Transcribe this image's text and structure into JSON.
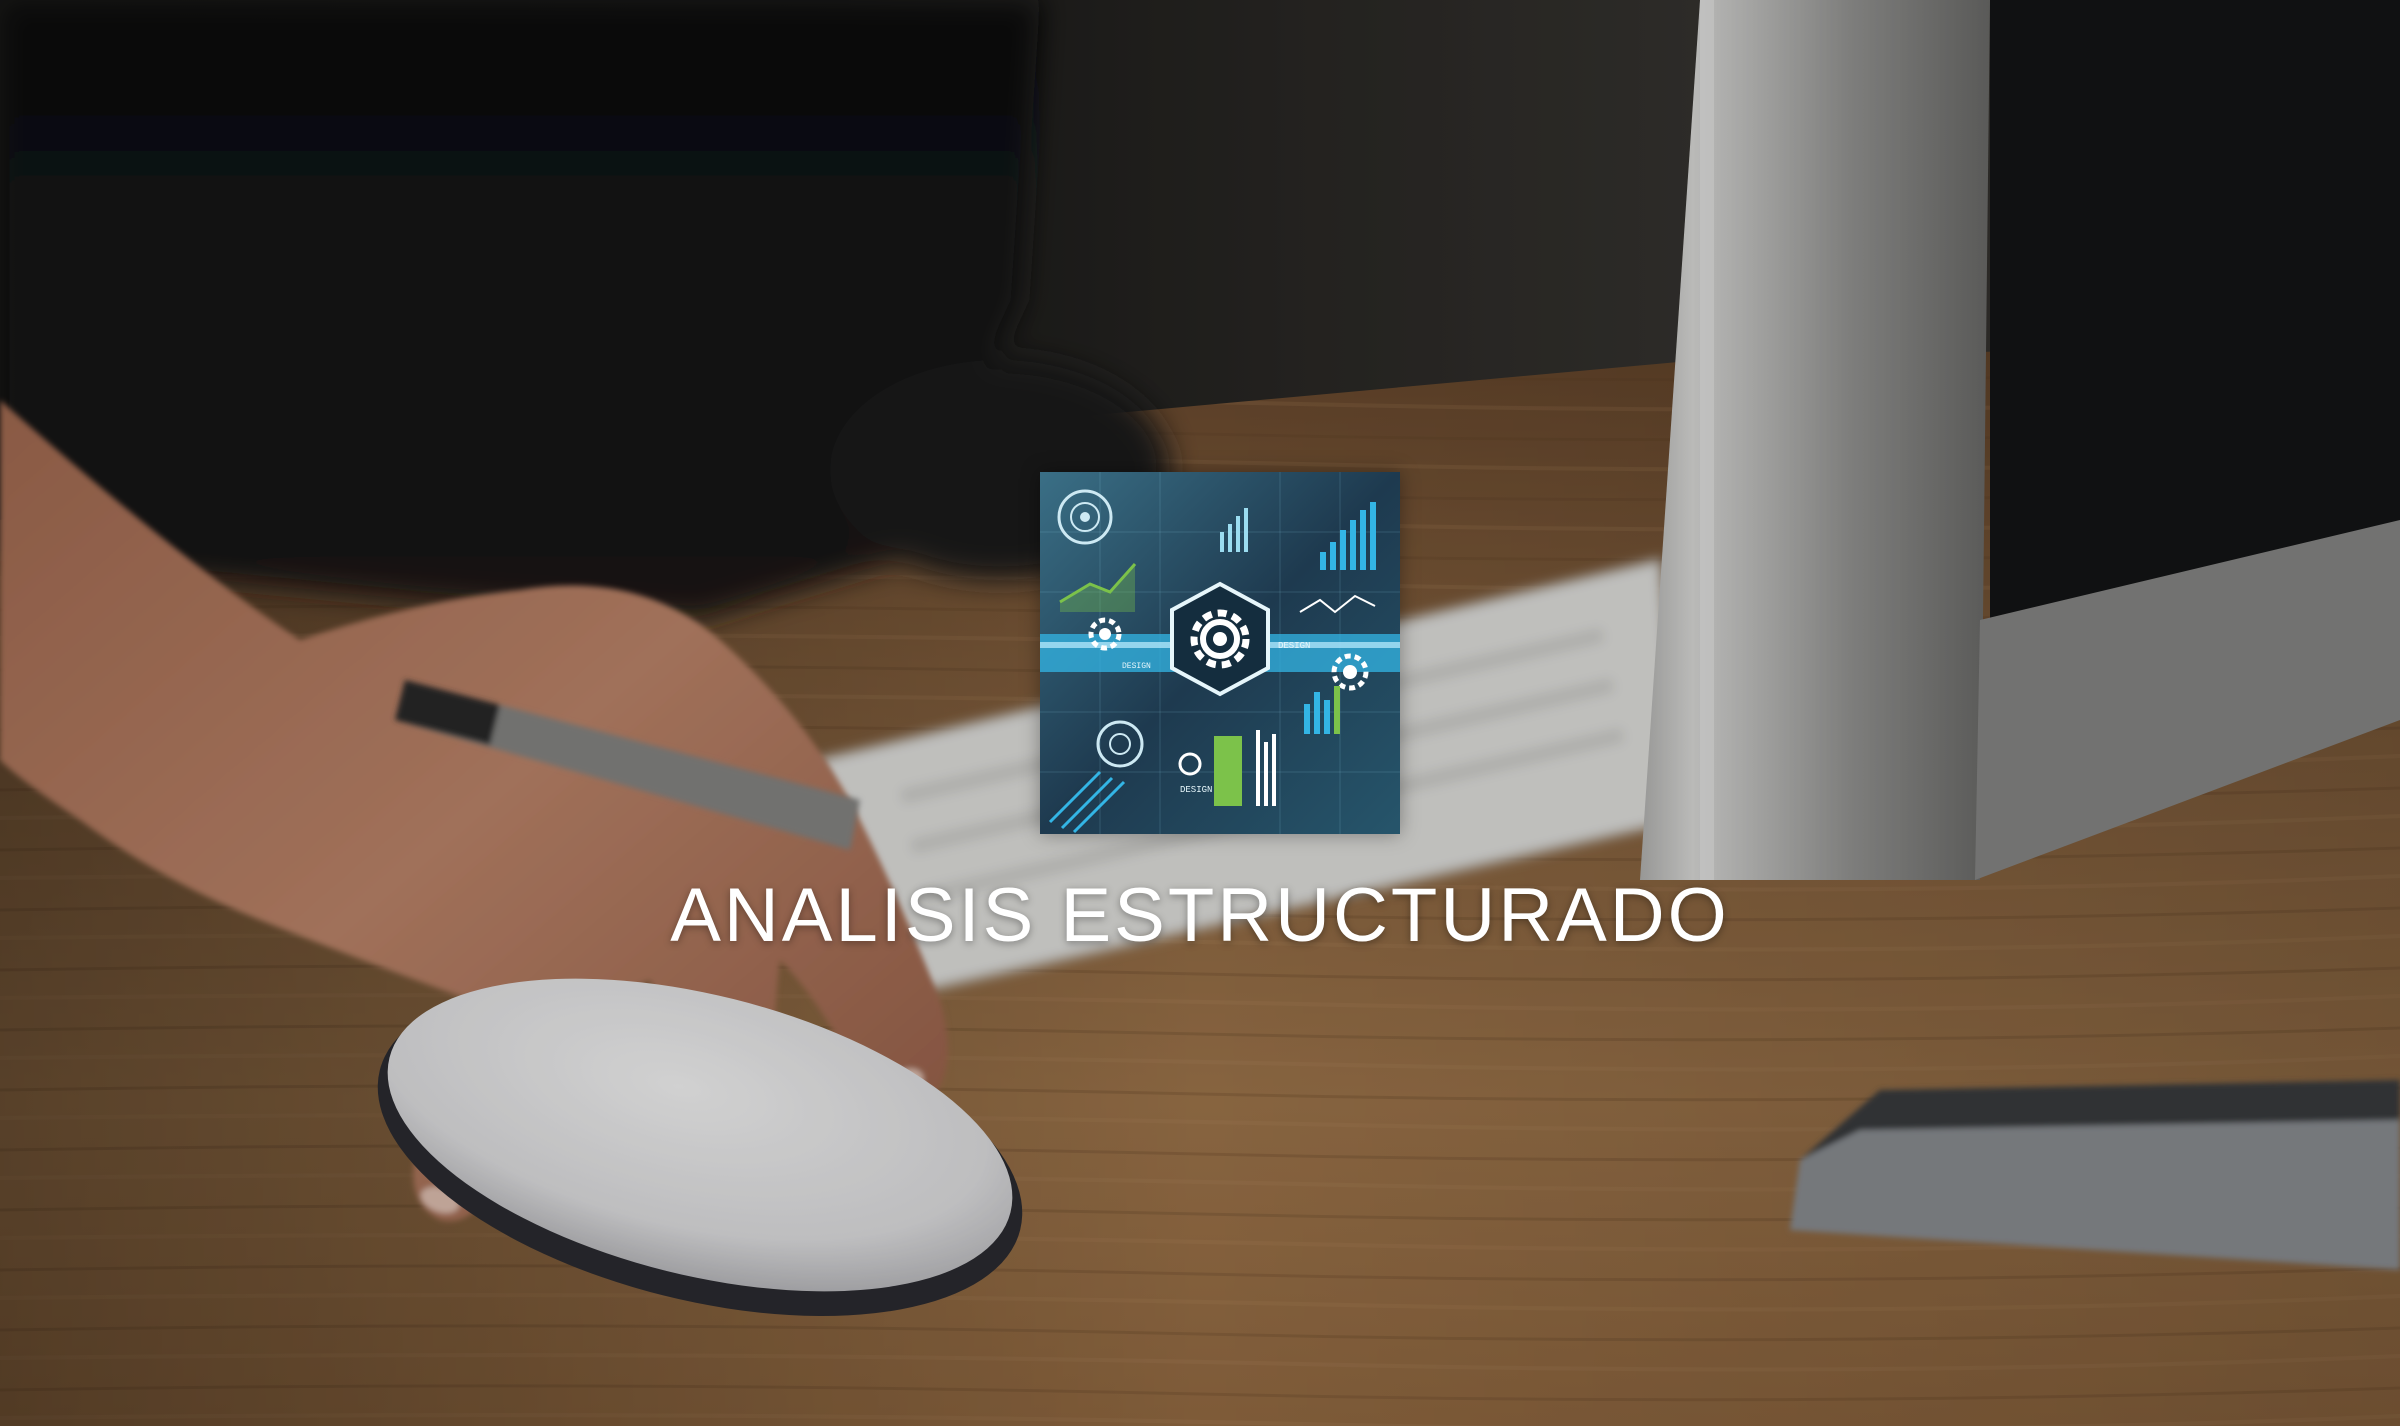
{
  "hero": {
    "title": "ANALISIS ESTRUCTURADO",
    "logo": {
      "icon": "gear-circuit-icon",
      "labels": {
        "top": "DESIGN",
        "left": "DESIGN",
        "bottom": "DESIGN"
      }
    }
  },
  "colors": {
    "title_text": "#ffffff",
    "logo_background": "#1e3a4f",
    "logo_accent": "#33b5e5",
    "logo_green": "#7cc24a"
  }
}
